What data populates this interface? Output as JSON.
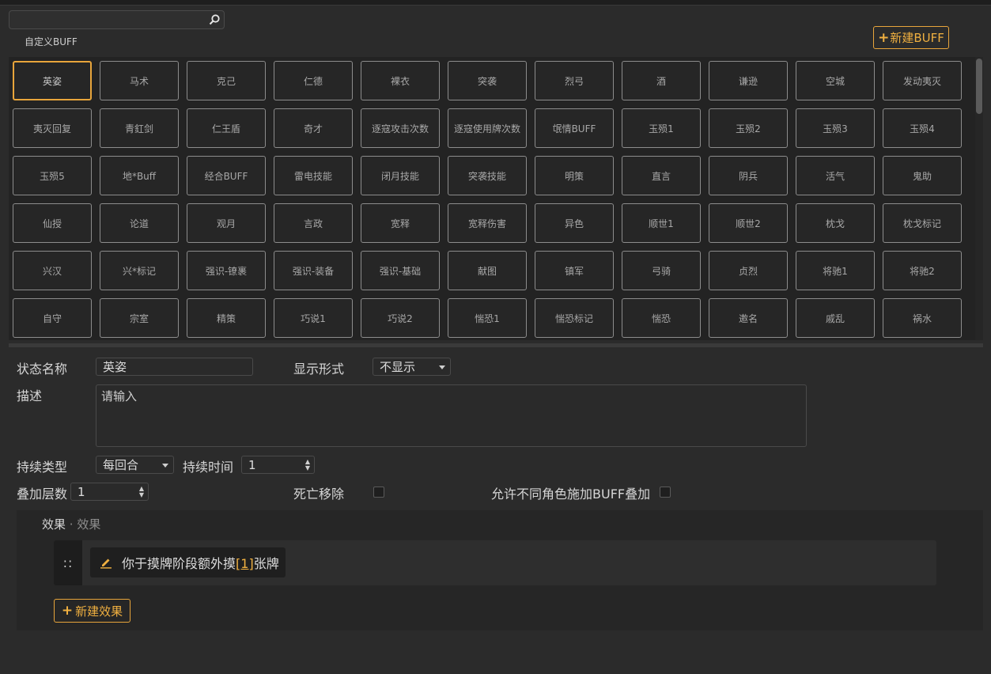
{
  "search": {
    "value": "",
    "placeholder": ""
  },
  "header": {
    "custom_label": "自定义BUFF",
    "new_buff_label": "新建BUFF"
  },
  "buffs": [
    "英姿",
    "马术",
    "克己",
    "仁德",
    "裸衣",
    "突袭",
    "烈弓",
    "酒",
    "谦逊",
    "空城",
    "发动夷灭",
    "夷灭回复",
    "青釭剑",
    "仁王盾",
    "奇才",
    "逐寇攻击次数",
    "逐寇使用牌次数",
    "氓情BUFF",
    "玉殒1",
    "玉殒2",
    "玉殒3",
    "玉殒4",
    "玉殒5",
    "地*Buff",
    "经合BUFF",
    "雷电技能",
    "闭月技能",
    "突袭技能",
    "明策",
    "直言",
    "阴兵",
    "活气",
    "鬼助",
    "仙授",
    "论道",
    "观月",
    "言政",
    "宽释",
    "宽释伤害",
    "异色",
    "顺世1",
    "顺世2",
    "枕戈",
    "枕戈标记",
    "兴汉",
    "兴*标记",
    "强识-镣裹",
    "强识-装备",
    "强识-基础",
    "献图",
    "镇军",
    "弓骑",
    "贞烈",
    "将驰1",
    "将驰2",
    "自守",
    "宗室",
    "精策",
    "巧说1",
    "巧说2",
    "惴恐1",
    "惴恐标记",
    "惴恐",
    "邀名",
    "戚乱",
    "祸水"
  ],
  "selected_buff": "英姿",
  "form": {
    "name_label": "状态名称",
    "name_value": "英姿",
    "display_label": "显示形式",
    "display_value": "不显示",
    "desc_label": "描述",
    "desc_placeholder": "请输入",
    "duration_type_label": "持续类型",
    "duration_type_value": "每回合",
    "duration_time_label": "持续时间",
    "duration_time_value": "1",
    "stack_label": "叠加层数",
    "stack_value": "1",
    "death_remove_label": "死亡移除",
    "death_remove_checked": false,
    "allow_diff_label": "允许不同角色施加BUFF叠加",
    "allow_diff_checked": false
  },
  "effects": {
    "title": "效果",
    "separator": " · ",
    "subtitle": "效果",
    "items": [
      {
        "text_before": "你于摸牌阶段额外摸",
        "param": "[1]",
        "text_after": "张牌"
      }
    ],
    "new_effect_label": "新建效果"
  },
  "colors": {
    "accent": "#e8a53b",
    "background": "#2b2b2b",
    "panel": "#232323"
  }
}
